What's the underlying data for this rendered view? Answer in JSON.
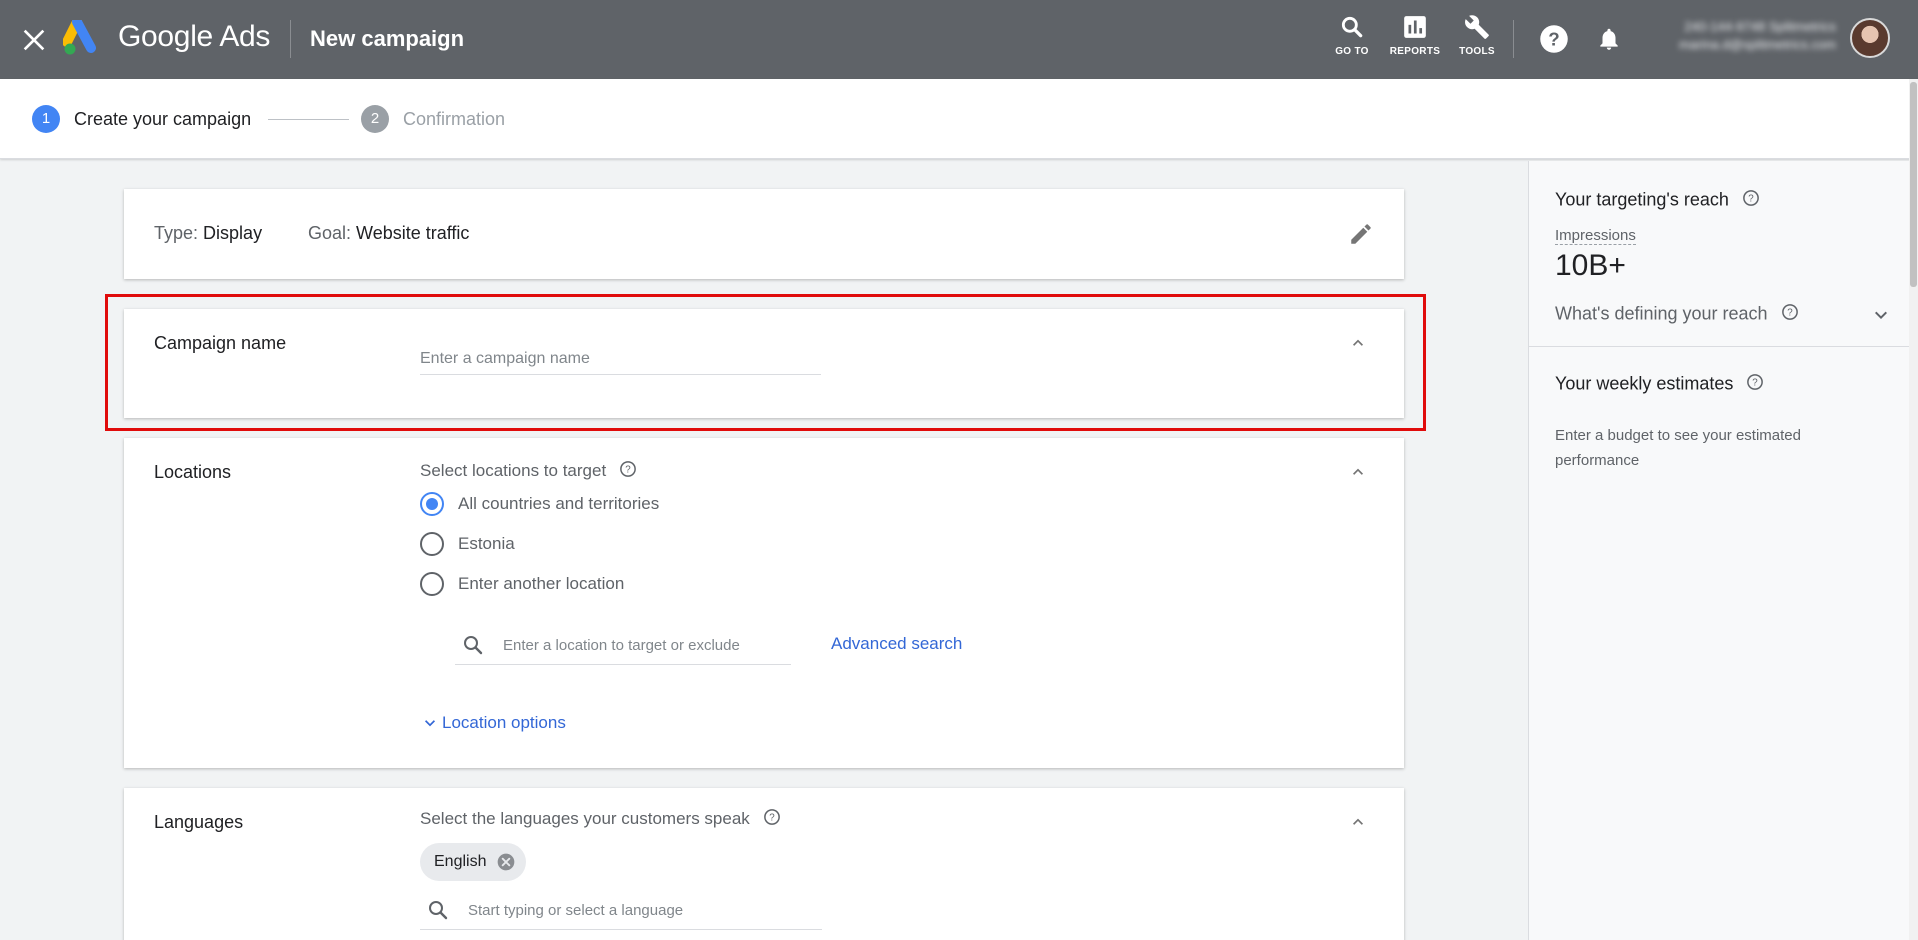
{
  "header": {
    "brand": "Google Ads",
    "page_title": "New campaign",
    "tools": [
      {
        "label": "GO TO",
        "icon": "search-icon"
      },
      {
        "label": "REPORTS",
        "icon": "reports-icon"
      },
      {
        "label": "TOOLS",
        "icon": "wrench-icon"
      }
    ],
    "account_id": "240-144-9748 Splitmetrics",
    "account_email": "marina.d@splitmetrics.com"
  },
  "stepper": {
    "steps": [
      {
        "num": "1",
        "label": "Create your campaign",
        "active": true
      },
      {
        "num": "2",
        "label": "Confirmation",
        "active": false
      }
    ]
  },
  "campaign_type": {
    "type_label": "Type:",
    "type_value": "Display",
    "goal_label": "Goal:",
    "goal_value": "Website traffic"
  },
  "campaign_name": {
    "label": "Campaign name",
    "placeholder": "Enter a campaign name",
    "value": ""
  },
  "locations": {
    "label": "Locations",
    "subtitle": "Select locations to target",
    "options": [
      {
        "label": "All countries and territories",
        "checked": true
      },
      {
        "label": "Estonia",
        "checked": false
      },
      {
        "label": "Enter another location",
        "checked": false
      }
    ],
    "search_placeholder": "Enter a location to target or exclude",
    "advanced_search": "Advanced search",
    "location_options": "Location options"
  },
  "languages": {
    "label": "Languages",
    "subtitle": "Select the languages your customers speak",
    "chips": [
      "English"
    ],
    "search_placeholder": "Start typing or select a language"
  },
  "right_panel": {
    "reach_title": "Your targeting's reach",
    "impressions_label": "Impressions",
    "impressions_value": "10B+",
    "defining_label": "What's defining your reach",
    "weekly_title": "Your weekly estimates",
    "weekly_desc": "Enter a budget to see your estimated performance"
  },
  "colors": {
    "header_bg": "#5f6368",
    "accent_blue": "#4285f4",
    "link_blue": "#3367d6",
    "highlight_red": "#e00b0b"
  }
}
